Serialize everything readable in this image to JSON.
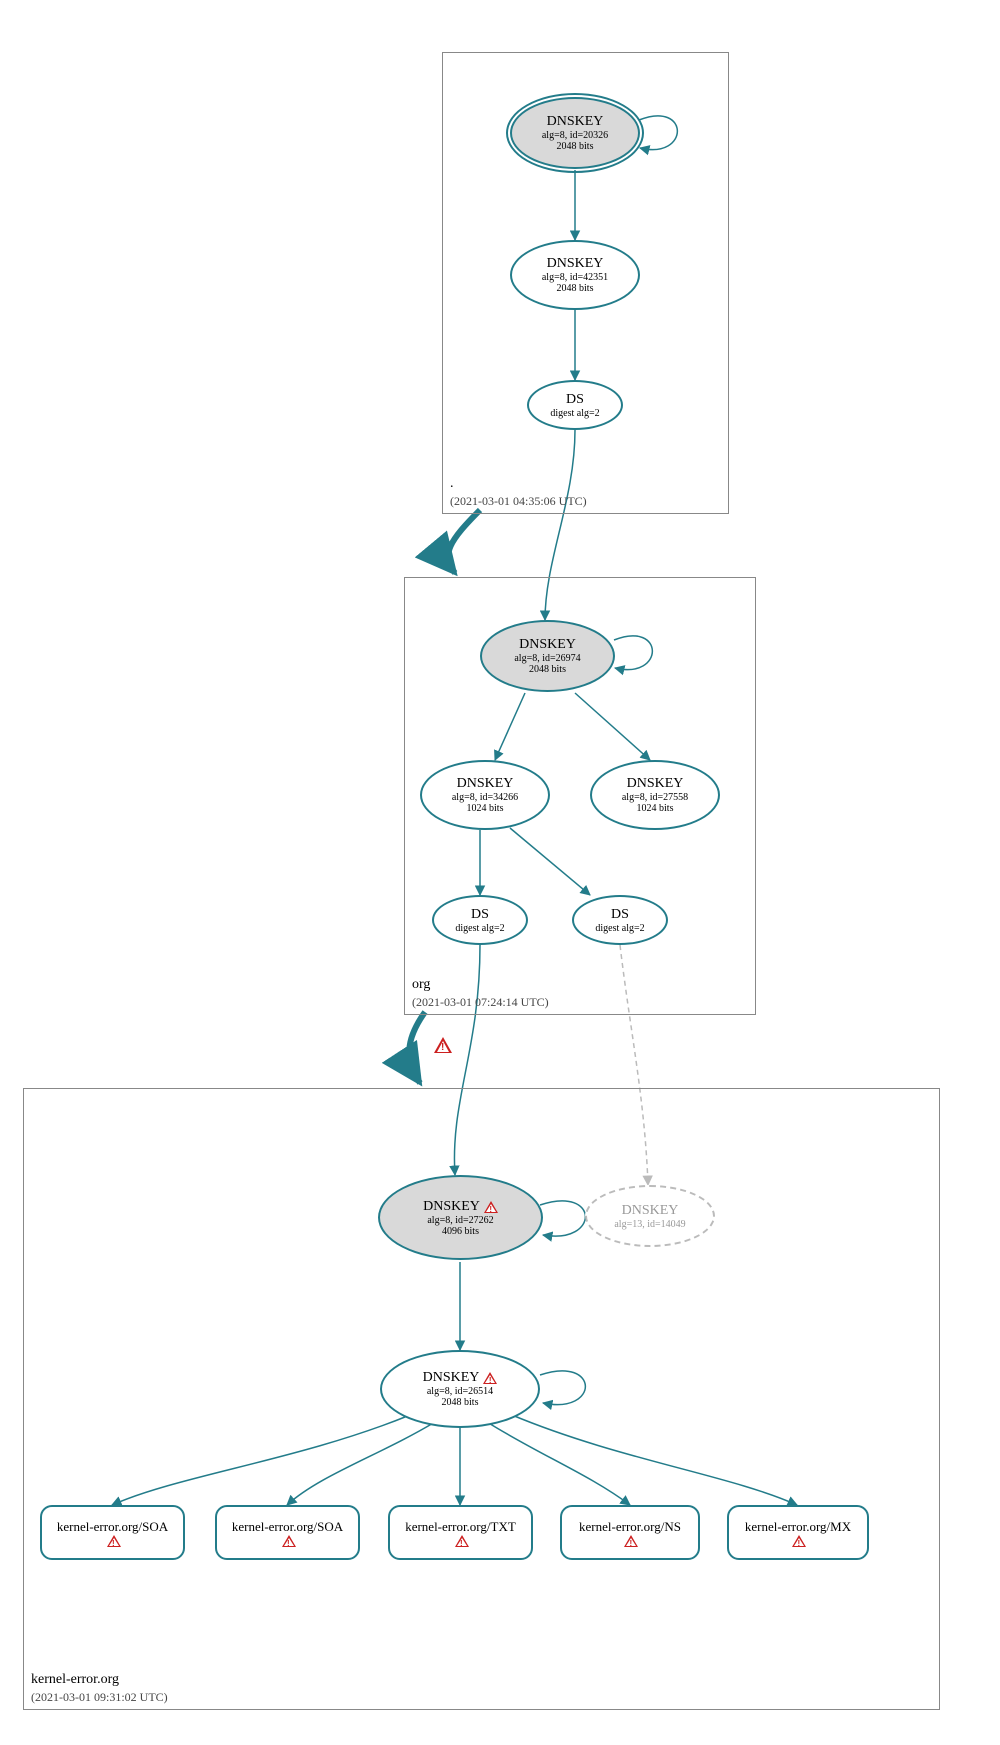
{
  "zones": {
    "root": {
      "name": ".",
      "timestamp": "(2021-03-01 04:35:06 UTC)"
    },
    "org": {
      "name": "org",
      "timestamp": "(2021-03-01 07:24:14 UTC)"
    },
    "ke": {
      "name": "kernel-error.org",
      "timestamp": "(2021-03-01 09:31:02 UTC)"
    }
  },
  "nodes": {
    "root_ksk": {
      "title": "DNSKEY",
      "line1": "alg=8, id=20326",
      "line2": "2048 bits"
    },
    "root_zsk": {
      "title": "DNSKEY",
      "line1": "alg=8, id=42351",
      "line2": "2048 bits"
    },
    "root_ds": {
      "title": "DS",
      "line1": "digest alg=2"
    },
    "org_ksk": {
      "title": "DNSKEY",
      "line1": "alg=8, id=26974",
      "line2": "2048 bits"
    },
    "org_zsk1": {
      "title": "DNSKEY",
      "line1": "alg=8, id=34266",
      "line2": "1024 bits"
    },
    "org_zsk2": {
      "title": "DNSKEY",
      "line1": "alg=8, id=27558",
      "line2": "1024 bits"
    },
    "org_ds1": {
      "title": "DS",
      "line1": "digest alg=2"
    },
    "org_ds2": {
      "title": "DS",
      "line1": "digest alg=2"
    },
    "ke_ksk": {
      "title": "DNSKEY",
      "line1": "alg=8, id=27262",
      "line2": "4096 bits"
    },
    "ke_zsk": {
      "title": "DNSKEY",
      "line1": "alg=8, id=26514",
      "line2": "2048 bits"
    },
    "ke_other": {
      "title": "DNSKEY",
      "line1": "alg=13, id=14049"
    }
  },
  "records": {
    "r1": "kernel-error.org/SOA",
    "r2": "kernel-error.org/SOA",
    "r3": "kernel-error.org/TXT",
    "r4": "kernel-error.org/NS",
    "r5": "kernel-error.org/MX"
  },
  "chart_data": {
    "type": "hierarchy",
    "title": "DNSSEC Authentication Chain for kernel-error.org",
    "zones": [
      {
        "name": ".",
        "timestamp": "2021-03-01 04:35:06 UTC",
        "nodes": [
          {
            "id": "root_ksk",
            "type": "DNSKEY",
            "alg": 8,
            "key_id": 20326,
            "bits": 2048,
            "role": "KSK",
            "trust_anchor": true
          },
          {
            "id": "root_zsk",
            "type": "DNSKEY",
            "alg": 8,
            "key_id": 42351,
            "bits": 2048,
            "role": "ZSK"
          },
          {
            "id": "root_ds",
            "type": "DS",
            "digest_alg": 2
          }
        ]
      },
      {
        "name": "org",
        "timestamp": "2021-03-01 07:24:14 UTC",
        "nodes": [
          {
            "id": "org_ksk",
            "type": "DNSKEY",
            "alg": 8,
            "key_id": 26974,
            "bits": 2048,
            "role": "KSK"
          },
          {
            "id": "org_zsk1",
            "type": "DNSKEY",
            "alg": 8,
            "key_id": 34266,
            "bits": 1024,
            "role": "ZSK"
          },
          {
            "id": "org_zsk2",
            "type": "DNSKEY",
            "alg": 8,
            "key_id": 27558,
            "bits": 1024,
            "role": "ZSK"
          },
          {
            "id": "org_ds1",
            "type": "DS",
            "digest_alg": 2
          },
          {
            "id": "org_ds2",
            "type": "DS",
            "digest_alg": 2
          }
        ]
      },
      {
        "name": "kernel-error.org",
        "timestamp": "2021-03-01 09:31:02 UTC",
        "nodes": [
          {
            "id": "ke_ksk",
            "type": "DNSKEY",
            "alg": 8,
            "key_id": 27262,
            "bits": 4096,
            "role": "KSK",
            "warning": true
          },
          {
            "id": "ke_zsk",
            "type": "DNSKEY",
            "alg": 8,
            "key_id": 26514,
            "bits": 2048,
            "role": "ZSK",
            "warning": true
          },
          {
            "id": "ke_other",
            "type": "DNSKEY",
            "alg": 13,
            "key_id": 14049,
            "role": "unknown",
            "dashed": true
          },
          {
            "id": "r1",
            "type": "RRset",
            "name": "kernel-error.org/SOA",
            "warning": true
          },
          {
            "id": "r2",
            "type": "RRset",
            "name": "kernel-error.org/SOA",
            "warning": true
          },
          {
            "id": "r3",
            "type": "RRset",
            "name": "kernel-error.org/TXT",
            "warning": true
          },
          {
            "id": "r4",
            "type": "RRset",
            "name": "kernel-error.org/NS",
            "warning": true
          },
          {
            "id": "r5",
            "type": "RRset",
            "name": "kernel-error.org/MX",
            "warning": true
          }
        ]
      }
    ],
    "edges": [
      {
        "from": "root_ksk",
        "to": "root_ksk",
        "self": true
      },
      {
        "from": "root_ksk",
        "to": "root_zsk"
      },
      {
        "from": "root_zsk",
        "to": "root_ds"
      },
      {
        "from": "root_ds",
        "to": "org_ksk"
      },
      {
        "from": "root_zone",
        "to": "org_zone",
        "delegation": true,
        "warning": true
      },
      {
        "from": "org_ksk",
        "to": "org_ksk",
        "self": true
      },
      {
        "from": "org_ksk",
        "to": "org_zsk1"
      },
      {
        "from": "org_ksk",
        "to": "org_zsk2"
      },
      {
        "from": "org_zsk1",
        "to": "org_ds1"
      },
      {
        "from": "org_zsk1",
        "to": "org_ds2"
      },
      {
        "from": "org_ds1",
        "to": "ke_ksk"
      },
      {
        "from": "org_ds2",
        "to": "ke_other",
        "dashed": true
      },
      {
        "from": "org_zone",
        "to": "ke_zone",
        "delegation": true,
        "warning": true
      },
      {
        "from": "ke_ksk",
        "to": "ke_ksk",
        "self": true
      },
      {
        "from": "ke_ksk",
        "to": "ke_zsk"
      },
      {
        "from": "ke_zsk",
        "to": "ke_zsk",
        "self": true
      },
      {
        "from": "ke_zsk",
        "to": "r1"
      },
      {
        "from": "ke_zsk",
        "to": "r2"
      },
      {
        "from": "ke_zsk",
        "to": "r3"
      },
      {
        "from": "ke_zsk",
        "to": "r4"
      },
      {
        "from": "ke_zsk",
        "to": "r5"
      }
    ]
  }
}
